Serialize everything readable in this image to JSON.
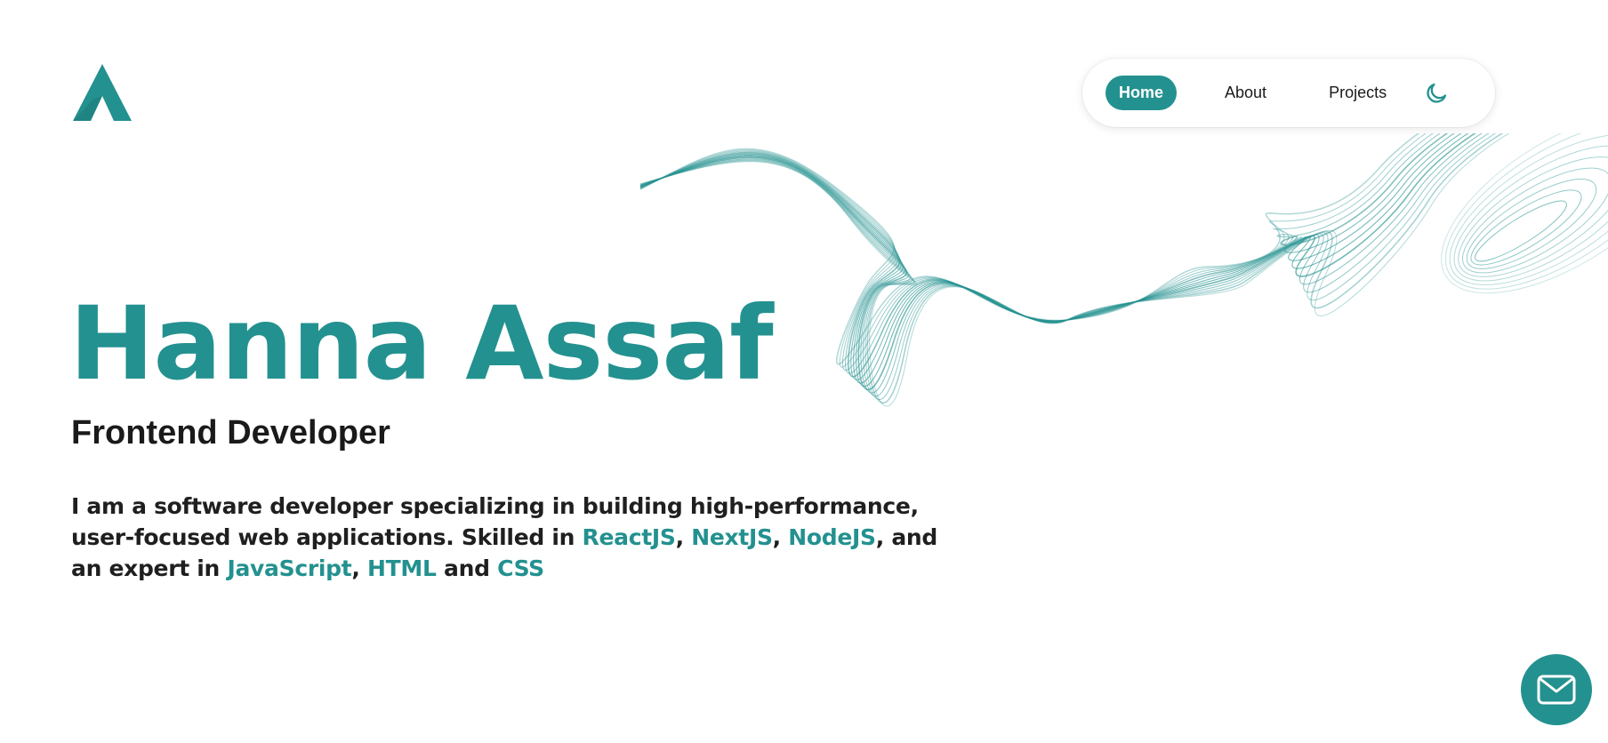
{
  "brand": {
    "logo_letter": "A",
    "accent_color": "#23918f"
  },
  "nav": {
    "items": [
      {
        "label": "Home",
        "active": true
      },
      {
        "label": "About",
        "active": false
      },
      {
        "label": "Projects",
        "active": false
      }
    ],
    "theme_toggle_icon": "moon-icon"
  },
  "hero": {
    "name": "Hanna Assaf",
    "role": "Frontend Developer",
    "bio": {
      "intro": "I am a software developer specializing in building high-performance, user-focused web applications. Skilled in ",
      "skill_1": "ReactJS",
      "sep_1": ", ",
      "skill_2": "NextJS",
      "sep_2": ", ",
      "skill_3": "NodeJS",
      "mid": ", and an expert in ",
      "skill_4": "JavaScript",
      "sep_3": ", ",
      "skill_5": "HTML",
      "sep_4": " and ",
      "skill_6": "CSS"
    }
  },
  "contact": {
    "icon": "mail-icon"
  }
}
